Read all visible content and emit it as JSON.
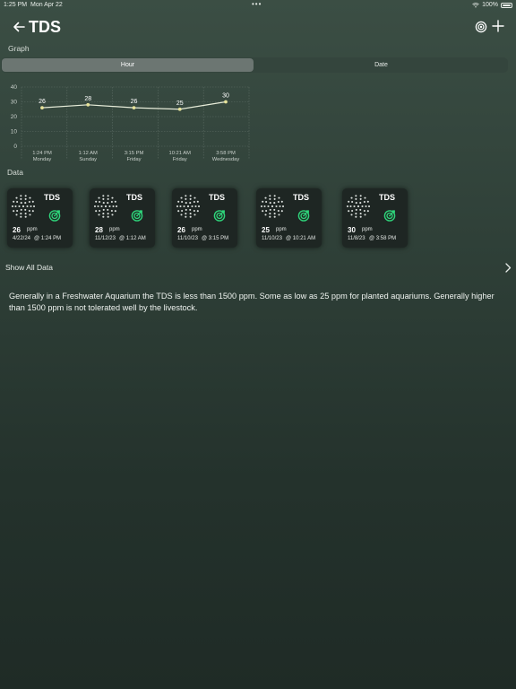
{
  "status_bar": {
    "time": "1:25 PM",
    "date": "Mon Apr 22",
    "battery": "100%"
  },
  "nav": {
    "title": "TDS",
    "back_icon": "arrow-left-icon",
    "settings_icon": "target-settings-icon",
    "add_icon": "plus-icon"
  },
  "graph": {
    "label": "Graph",
    "tabs": [
      {
        "label": "Hour",
        "selected": true
      },
      {
        "label": "Date",
        "selected": false
      }
    ]
  },
  "chart_data": {
    "type": "line",
    "categories": [
      "1:24 PM",
      "1:12 AM",
      "3:15 PM",
      "10:21 AM",
      "3:58 PM"
    ],
    "category_days": [
      "Monday",
      "Sunday",
      "Friday",
      "Friday",
      "Wednesday"
    ],
    "values": [
      26,
      28,
      26,
      25,
      30
    ],
    "data_labels": [
      "26",
      "28",
      "26",
      "25",
      "30"
    ],
    "y_ticks": [
      "0",
      "10",
      "20",
      "30",
      "40"
    ],
    "ylim": [
      0,
      40
    ],
    "grid": true,
    "line_color": "#e7ecd9",
    "point_color": "#e6e29a"
  },
  "data_section": {
    "label": "Data",
    "cards": [
      {
        "title": "TDS",
        "value": "26",
        "unit": "ppm",
        "date": "4/22/24",
        "time": "@ 1:24 PM"
      },
      {
        "title": "TDS",
        "value": "28",
        "unit": "ppm",
        "date": "11/12/23",
        "time": "@ 1:12 AM"
      },
      {
        "title": "TDS",
        "value": "26",
        "unit": "ppm",
        "date": "11/10/23",
        "time": "@ 3:15 PM"
      },
      {
        "title": "TDS",
        "value": "25",
        "unit": "ppm",
        "date": "11/10/23",
        "time": "@ 10:21 AM"
      },
      {
        "title": "TDS",
        "value": "30",
        "unit": "ppm",
        "date": "11/8/23",
        "time": "@ 3:58 PM"
      }
    ],
    "card_icon": "dot-grid-icon",
    "status_icon": "target-icon",
    "accent_color": "#2ed47a"
  },
  "show_all": {
    "label": "Show All Data"
  },
  "description": "Generally in a Freshwater Aquarium the TDS is less than 1500 ppm. Some as low as 25 ppm for planted aquariums. Generally higher than 1500 ppm is not tolerated well by the livestock."
}
